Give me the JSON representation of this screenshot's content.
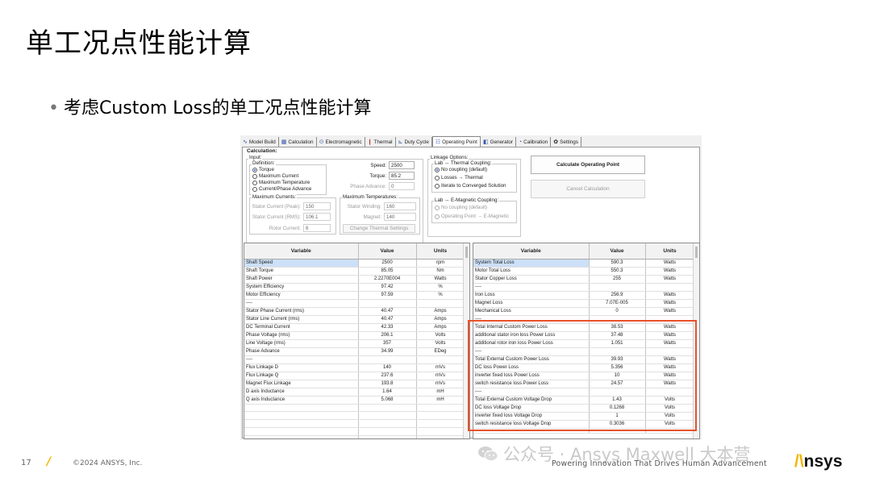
{
  "slide": {
    "title": "单工况点性能计算",
    "bullet": "考虑Custom Loss的单工况点性能计算",
    "page_number": "17",
    "copyright": "©2024 ANSYS, Inc.",
    "tagline": "Powering Innovation That Drives Human Advancement",
    "logo_text": "nsys",
    "logo_accent": "/\\",
    "watermark": "公众号 · Ansys Maxwell 大本营"
  },
  "tabs": [
    {
      "label": "Model Build",
      "icon": "wave-icon"
    },
    {
      "label": "Calculation",
      "icon": "grid-icon"
    },
    {
      "label": "Electromagnetic",
      "icon": "magnet-icon"
    },
    {
      "label": "Thermal",
      "icon": "thermometer-icon"
    },
    {
      "label": "Duty Cycle",
      "icon": "chart-icon"
    },
    {
      "label": "Operating Point",
      "icon": "table-icon",
      "active": true
    },
    {
      "label": "Generator",
      "icon": "generator-icon"
    },
    {
      "label": "Calibration",
      "icon": "calibration-icon"
    },
    {
      "label": "Settings",
      "icon": "gear-icon"
    }
  ],
  "calc": {
    "title": "Calculation:",
    "input_label": "Input:",
    "definition_label": "Definition:",
    "definition_options": [
      "Torque",
      "Maximum Current",
      "Maximum Temperature",
      "Current/Phase Advance"
    ],
    "speed_label": "Speed:",
    "speed_value": "2500",
    "torque_label": "Torque:",
    "torque_value": "85.2",
    "phase_advance_label": "Phase Advance:",
    "phase_advance_value": "0",
    "max_currents_label": "Maximum Currents:",
    "stator_peak_label": "Stator Current (Peak):",
    "stator_peak_value": "150",
    "stator_rms_label": "Stator Current (RMS):",
    "stator_rms_value": "106.1",
    "rotor_current_label": "Rotor Current:",
    "rotor_current_value": "6",
    "max_temps_label": "Maximum Temperatures:",
    "stator_winding_label": "Stator Winding:",
    "stator_winding_value": "160",
    "magnet_label": "Magnet:",
    "magnet_value": "140",
    "change_thermal_label": "Change Thermal Settings",
    "linkage_label": "Linkage Options:",
    "thermal_coupling_label": "Lab ↔ Thermal Coupling:",
    "thermal_options": [
      "No coupling (default)",
      "Losses → Thermal",
      "Iterate to Converged Solution"
    ],
    "emag_coupling_label": "Lab ↔ E-Magnetic Coupling:",
    "emag_options": [
      "No coupling (default)",
      "Operating Point → E-Magnetic"
    ],
    "calc_button": "Calculate Operating Point",
    "cancel_button": "Cancel Calculation"
  },
  "table_headers": {
    "variable": "Variable",
    "value": "Value",
    "units": "Units"
  },
  "left_table": [
    {
      "n": "Shaft Speed",
      "v": "2500",
      "u": "rpm"
    },
    {
      "n": "Shaft Torque",
      "v": "85.05",
      "u": "Nm"
    },
    {
      "n": "Shaft Power",
      "v": "2.2270E004",
      "u": "Watts"
    },
    {
      "n": "System Efficiency",
      "v": "97.42",
      "u": "%"
    },
    {
      "n": "Motor Efficiency",
      "v": "97.59",
      "u": "%"
    },
    {
      "n": "----",
      "v": "",
      "u": ""
    },
    {
      "n": "Stator Phase Current (rms)",
      "v": "40.47",
      "u": "Amps"
    },
    {
      "n": "Stator Line Current (rms)",
      "v": "40.47",
      "u": "Amps"
    },
    {
      "n": "DC Terminal Current",
      "v": "42.33",
      "u": "Amps"
    },
    {
      "n": "Phase Voltage (rms)",
      "v": "206.1",
      "u": "Volts"
    },
    {
      "n": "Line Voltage (rms)",
      "v": "357",
      "u": "Volts"
    },
    {
      "n": "Phase Advance",
      "v": "34.99",
      "u": "EDeg"
    },
    {
      "n": "----",
      "v": "",
      "u": ""
    },
    {
      "n": "Flux Linkage D",
      "v": "140",
      "u": "mVs"
    },
    {
      "n": "Flux Linkage Q",
      "v": "237.6",
      "u": "mVs"
    },
    {
      "n": "Magnet Flux Linkage",
      "v": "193.8",
      "u": "mVs"
    },
    {
      "n": "D axis Inductance",
      "v": "1.64",
      "u": "mH"
    },
    {
      "n": "Q axis Inductance",
      "v": "5.068",
      "u": "mH"
    },
    {
      "n": "",
      "v": "",
      "u": ""
    },
    {
      "n": "",
      "v": "",
      "u": ""
    },
    {
      "n": "",
      "v": "",
      "u": ""
    },
    {
      "n": "",
      "v": "",
      "u": ""
    },
    {
      "n": "",
      "v": "",
      "u": ""
    }
  ],
  "right_table": [
    {
      "n": "System Total Loss",
      "v": "590.3",
      "u": "Watts"
    },
    {
      "n": "Motor Total Loss",
      "v": "550.3",
      "u": "Watts"
    },
    {
      "n": "Stator Copper Loss",
      "v": "255",
      "u": "Watts"
    },
    {
      "n": "----",
      "v": "",
      "u": ""
    },
    {
      "n": "Iron Loss",
      "v": "256.9",
      "u": "Watts"
    },
    {
      "n": "Magnet Loss",
      "v": "7.07E-005",
      "u": "Watts"
    },
    {
      "n": "Mechanical Loss",
      "v": "0",
      "u": "Watts"
    },
    {
      "n": "----",
      "v": "",
      "u": ""
    },
    {
      "n": "Total Internal Custom Power Loss",
      "v": "38.53",
      "u": "Watts"
    },
    {
      "n": "additional stator iron loss Power Loss",
      "v": "37.48",
      "u": "Watts"
    },
    {
      "n": "additional rotor iron loss Power Loss",
      "v": "1.051",
      "u": "Watts"
    },
    {
      "n": "----",
      "v": "",
      "u": ""
    },
    {
      "n": "Total External Custom Power Loss",
      "v": "39.93",
      "u": "Watts"
    },
    {
      "n": "DC loss Power Loss",
      "v": "5.356",
      "u": "Watts"
    },
    {
      "n": "inverter fixed loss Power Loss",
      "v": "10",
      "u": "Watts"
    },
    {
      "n": "switch resistance loss Power Loss",
      "v": "24.57",
      "u": "Watts"
    },
    {
      "n": "----",
      "v": "",
      "u": ""
    },
    {
      "n": "Total External Custom Voltage Drop",
      "v": "1.43",
      "u": "Volts"
    },
    {
      "n": "DC loss Voltage Drop",
      "v": "0.1268",
      "u": "Volts"
    },
    {
      "n": "inverter fixed loss Voltage Drop",
      "v": "1",
      "u": "Volts"
    },
    {
      "n": "switch resistance loss Voltage Drop",
      "v": "0.3036",
      "u": "Volts"
    }
  ],
  "colors": {
    "highlight": "#e8512a",
    "ansys_yellow": "#f2b600",
    "selection": "#cce0f7"
  }
}
